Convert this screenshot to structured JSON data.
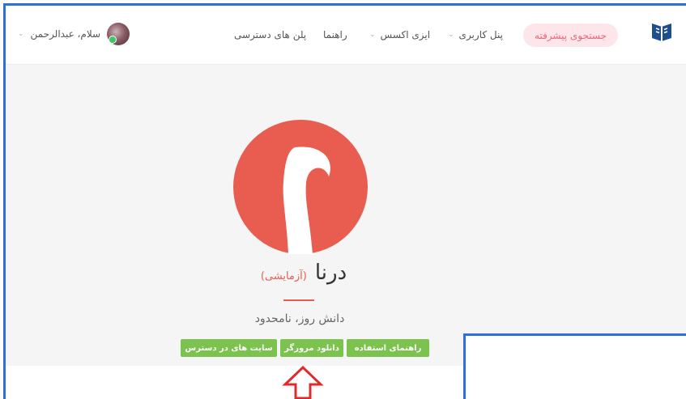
{
  "nav": {
    "advanced_search": "جستجوی پیشرفته",
    "user_panel": "پنل کاربری",
    "easy_access": "ایزی اکسس",
    "guide": "راهنما",
    "access_plans": "پلن های دسترسی",
    "greeting": "سلام، عبدالرحمن"
  },
  "product": {
    "name": "درنا",
    "tag": "(آزمایشی)",
    "subtitle": "دانش روز، نامحدود"
  },
  "buttons": {
    "guide": "راهنمای استفاده",
    "download": "دانلود مرورگر",
    "sites": "سایت های در دسترس"
  },
  "colors": {
    "accent_red": "#e85d4f",
    "button_green": "#7cc24e",
    "pill_bg": "#fde6ea",
    "pill_text": "#e9677c",
    "frame_blue": "#2f6fd6"
  },
  "icons": {
    "logo": "book-logo-icon",
    "chevron": "chevron-down-icon",
    "product_logo": "bird-logo-icon",
    "arrow": "up-arrow-icon"
  }
}
